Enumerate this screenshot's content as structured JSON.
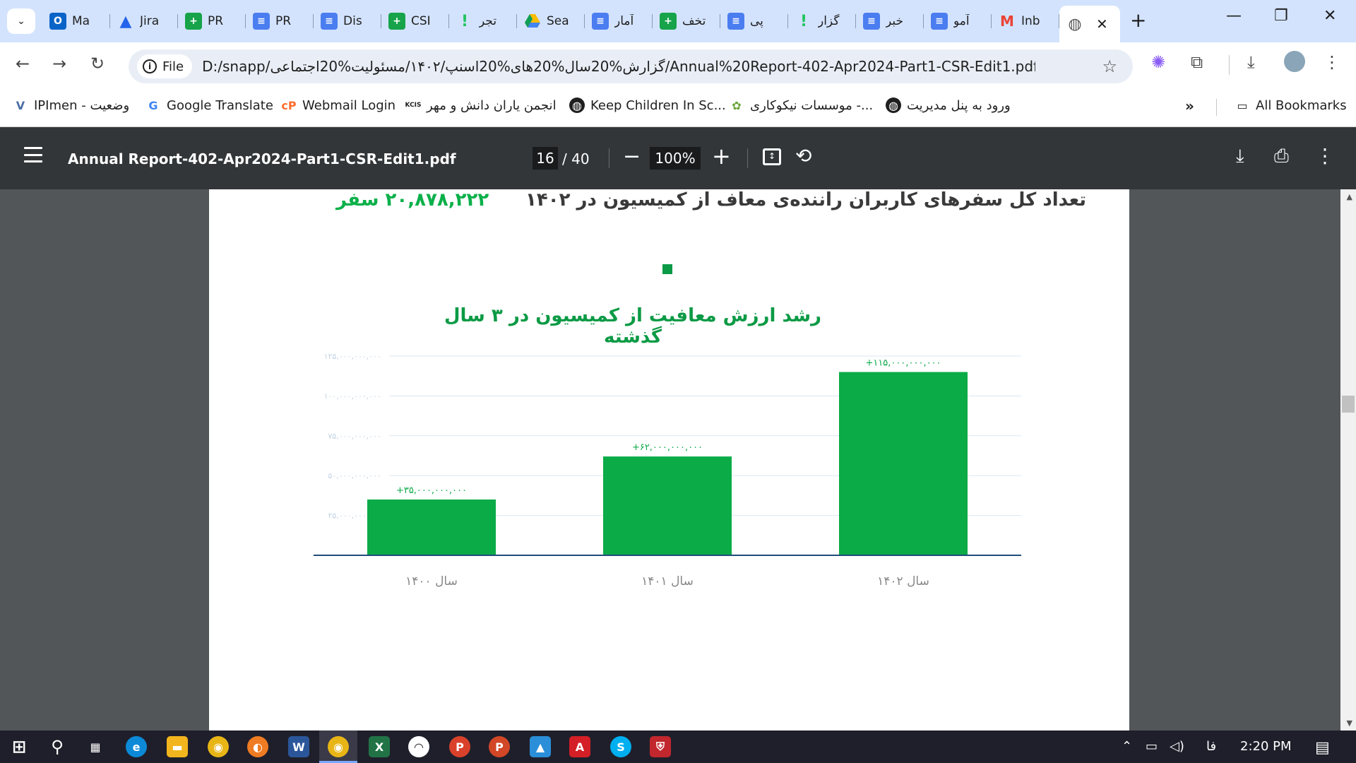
{
  "browser": {
    "tabs": [
      {
        "title": "Ma",
        "icon": "outlook-icon",
        "kind": "outlook",
        "glyph": "O"
      },
      {
        "title": "Jira",
        "icon": "jira-icon",
        "kind": "jira",
        "glyph": "▲"
      },
      {
        "title": "PR",
        "icon": "sheets-icon",
        "kind": "sheet",
        "glyph": "+"
      },
      {
        "title": "PR",
        "icon": "docs-icon",
        "kind": "doc",
        "glyph": "≡"
      },
      {
        "title": "Dis",
        "icon": "docs-icon",
        "kind": "doc",
        "glyph": "≡"
      },
      {
        "title": "CSI",
        "icon": "sheets-icon",
        "kind": "sheet",
        "glyph": "+"
      },
      {
        "title": "تجر",
        "icon": "exclamation-icon",
        "kind": "green",
        "glyph": "!"
      },
      {
        "title": "Sea",
        "icon": "google-drive-icon",
        "kind": "drive",
        "glyph": "▲"
      },
      {
        "title": "آمار",
        "icon": "docs-icon",
        "kind": "doc",
        "glyph": "≡"
      },
      {
        "title": "تخف",
        "icon": "sheets-icon",
        "kind": "sheet",
        "glyph": "+"
      },
      {
        "title": "پی",
        "icon": "docs-icon",
        "kind": "doc",
        "glyph": "≡"
      },
      {
        "title": "گزار",
        "icon": "exclamation-icon",
        "kind": "green",
        "glyph": "!"
      },
      {
        "title": "خبر",
        "icon": "docs-icon",
        "kind": "doc",
        "glyph": "≡"
      },
      {
        "title": "آمو",
        "icon": "docs-icon",
        "kind": "doc",
        "glyph": "≡"
      },
      {
        "title": "Inb",
        "icon": "gmail-icon",
        "kind": "gmail",
        "glyph": "M"
      }
    ],
    "address": {
      "scheme_label": "File",
      "url": "D:/snapp/گزارش%20سال%20های%20اسنپ/۱۴۰۲/مسئولیت%20اجتماعی/Annual%20Report-402-Apr2024-Part1-CSR-Edit1.pdf"
    },
    "bookmarks": [
      {
        "label": "IPImen - وضعیت",
        "icon": "ipimen-icon"
      },
      {
        "label": "Google Translate",
        "icon": "google-translate-icon"
      },
      {
        "label": "Webmail Login",
        "icon": "cpanel-icon"
      },
      {
        "label": "انجمن یاران دانش و مهر",
        "icon": "kcis-icon"
      },
      {
        "label": "Keep Children In Sc...",
        "icon": "globe-icon"
      },
      {
        "label": "موسسات نیکوکاری -...",
        "icon": "flower-icon"
      },
      {
        "label": "ورود به پنل مدیریت",
        "icon": "globe-icon"
      }
    ],
    "all_bookmarks_label": "All Bookmarks"
  },
  "pdf": {
    "title": "Annual Report-402-Apr2024-Part1-CSR-Edit1.pdf",
    "page_current": "16",
    "page_total": "/ 40",
    "zoom": "100%"
  },
  "document": {
    "stat_label": "تعداد کل سفرهای کاربران راننده‌ی معاف از کمیسیون در ۱۴۰۲",
    "stat_value": "۲۰,۸۷۸,۲۲۲ سفر",
    "colors": {
      "accent": "#0bab48",
      "axis": "#1f4e79",
      "grid": "#dbe7f2",
      "tick": "#c2d3e4",
      "label_text": "#888888"
    }
  },
  "chart_data": {
    "type": "bar",
    "title": "رشد ارزش معافیت از کمیسیون در ۳ سال گذشته",
    "categories": [
      "سال ۱۴۰۰",
      "سال ۱۴۰۱",
      "سال ۱۴۰۲"
    ],
    "values": [
      35000000000,
      62000000000,
      115000000000
    ],
    "data_labels": [
      "+۳۵,۰۰۰,۰۰۰,۰۰۰",
      "+۶۲,۰۰۰,۰۰۰,۰۰۰",
      "+۱۱۵,۰۰۰,۰۰۰,۰۰۰"
    ],
    "ylim": [
      0,
      125000000000
    ],
    "yticks": [
      25000000000,
      50000000000,
      75000000000,
      100000000000,
      125000000000
    ],
    "ytick_labels": [
      "۲۵,۰۰۰,۰۰۰,۰۰۰",
      "۵۰,۰۰۰,۰۰۰,۰۰۰",
      "۷۵,۰۰۰,۰۰۰,۰۰۰",
      "۱۰۰,۰۰۰,۰۰۰,۰۰۰",
      "۱۲۵,۰۰۰,۰۰۰,۰۰۰"
    ],
    "grid": true,
    "xlabel": "",
    "ylabel": ""
  },
  "taskbar": {
    "apps": [
      {
        "name": "start-icon"
      },
      {
        "name": "search-icon"
      },
      {
        "name": "task-view-icon"
      },
      {
        "name": "edge-icon"
      },
      {
        "name": "file-explorer-icon"
      },
      {
        "name": "chrome-icon"
      },
      {
        "name": "firefox-icon"
      },
      {
        "name": "word-icon"
      },
      {
        "name": "chrome-active-icon"
      },
      {
        "name": "excel-icon"
      },
      {
        "name": "app-icon"
      },
      {
        "name": "p-app-icon"
      },
      {
        "name": "powerpoint-icon"
      },
      {
        "name": "photos-icon"
      },
      {
        "name": "acrobat-icon"
      },
      {
        "name": "skype-icon"
      },
      {
        "name": "shield-app-icon"
      }
    ],
    "language": "فا",
    "time": "2:20 PM"
  }
}
